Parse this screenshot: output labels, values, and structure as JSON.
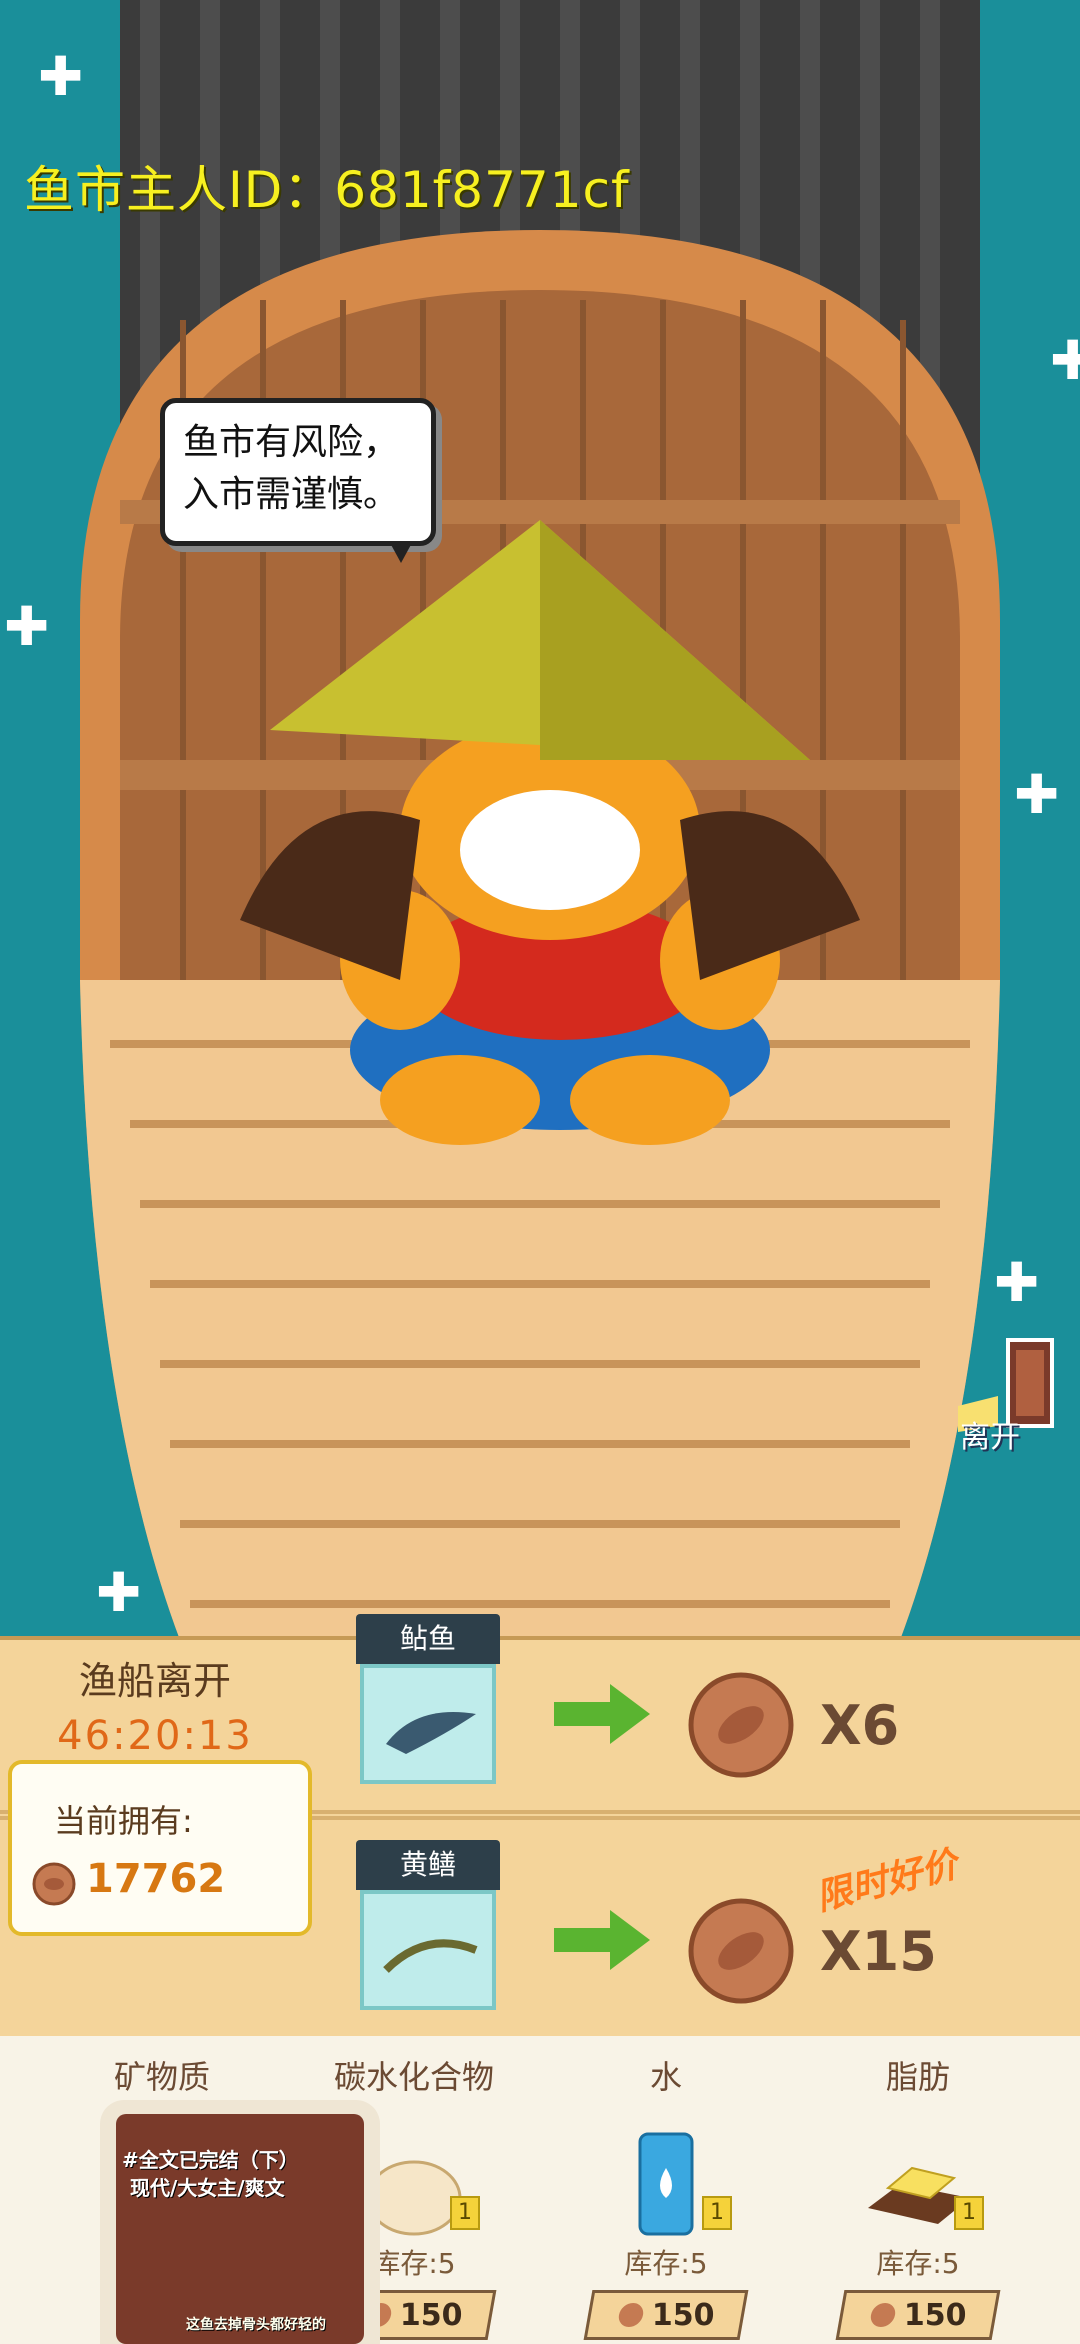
{
  "owner": {
    "label": "鱼市主人ID：681f8771cf"
  },
  "speech": {
    "line1": "鱼市有风险，",
    "line2": "入市需谨慎。"
  },
  "leave": {
    "label": "离开"
  },
  "departure": {
    "label": "渔船离开",
    "countdown": "46:20:13"
  },
  "wallet": {
    "label": "当前拥有:",
    "amount": "17762"
  },
  "trades": [
    {
      "fish": "鲇鱼",
      "quantity": "X6",
      "promo": ""
    },
    {
      "fish": "黄鳝",
      "quantity": "X15",
      "promo": "限时好价"
    }
  ],
  "nutrients": [
    {
      "title": "矿物质",
      "stock": "",
      "price": "",
      "badge": ""
    },
    {
      "title": "碳水化合物",
      "stock": "库存:5",
      "price": "150",
      "badge": "1"
    },
    {
      "title": "水",
      "stock": "库存:5",
      "price": "150",
      "badge": "1"
    },
    {
      "title": "脂肪",
      "stock": "库存:5",
      "price": "150",
      "badge": "1"
    }
  ],
  "video_overlay": {
    "caption1": "#全文已完结（下）",
    "caption2": "现代/大女主/爽文",
    "caption3": "这鱼去掉骨头都好轻的"
  },
  "colors": {
    "sea": "#1a8f9a",
    "id_text": "#f7f020",
    "coin": "#c57a52",
    "countdown": "#e06818"
  }
}
